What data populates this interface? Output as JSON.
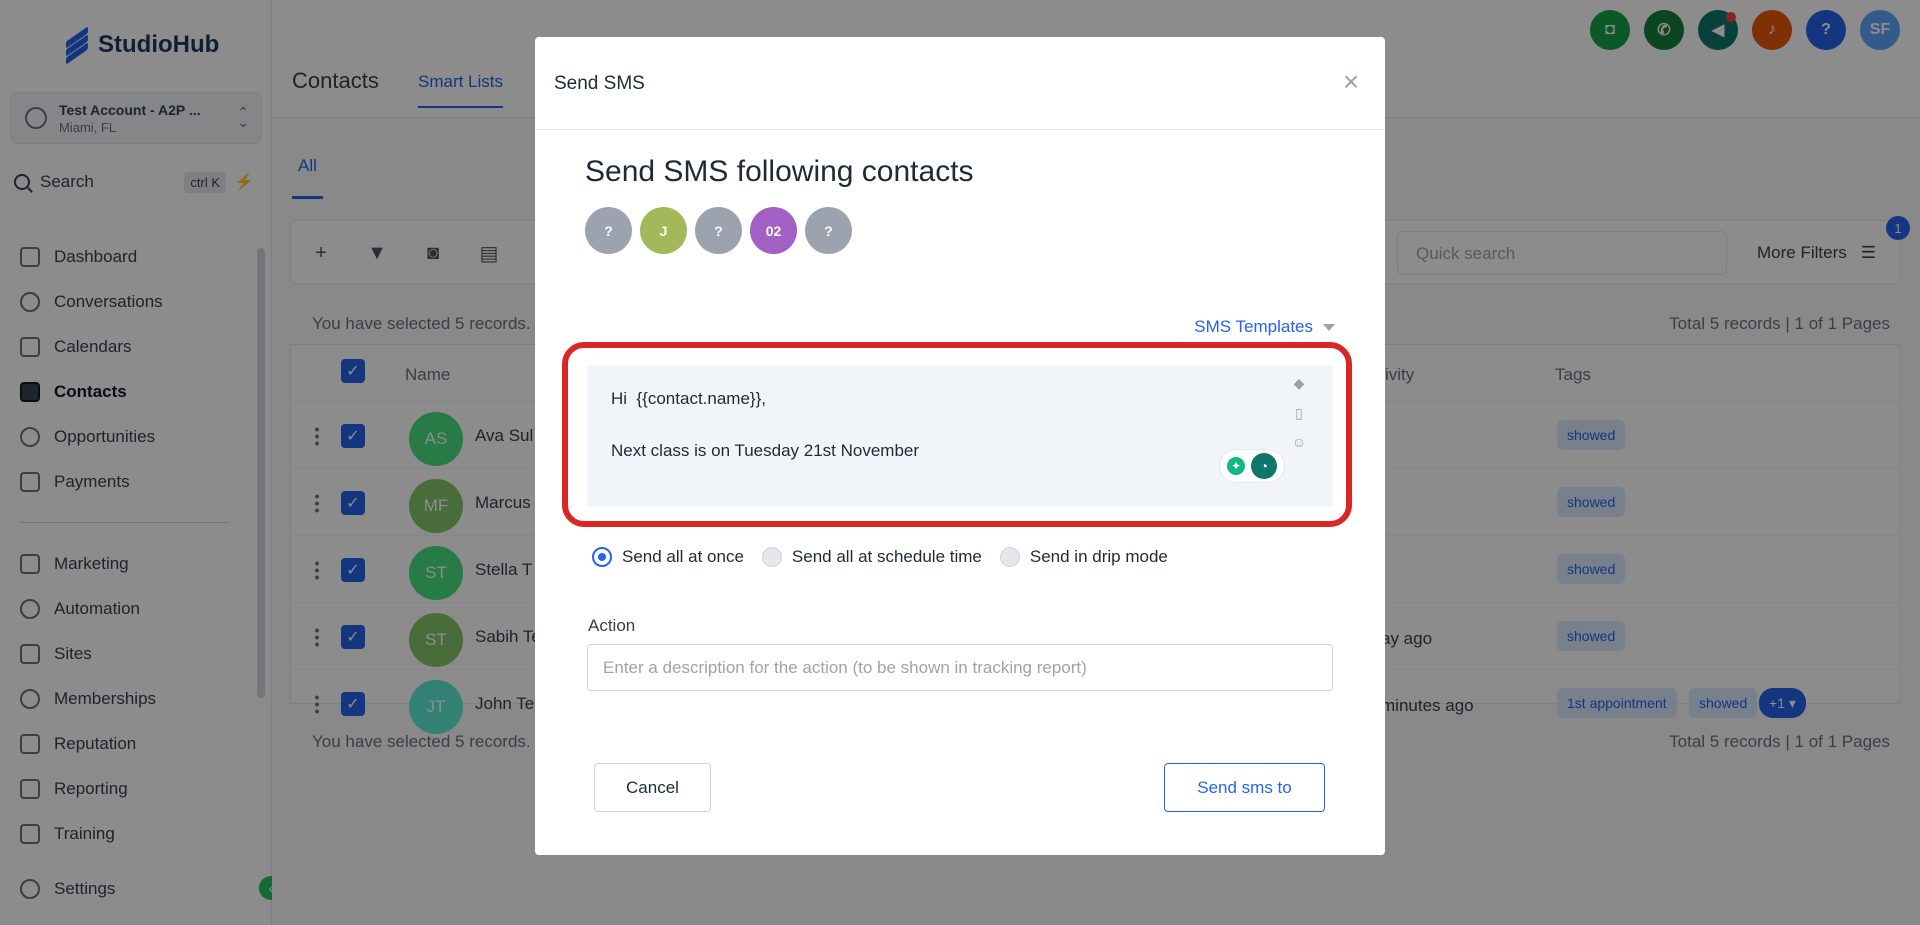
{
  "brand": {
    "name": "StudioHub"
  },
  "account": {
    "name": "Test Account - A2P ...",
    "location": "Miami, FL"
  },
  "search": {
    "label": "Search",
    "shortcut": "ctrl K"
  },
  "nav": {
    "items": [
      {
        "label": "Dashboard",
        "icon": "dashboard-icon"
      },
      {
        "label": "Conversations",
        "icon": "chat-icon"
      },
      {
        "label": "Calendars",
        "icon": "calendar-icon"
      },
      {
        "label": "Contacts",
        "icon": "contacts-icon",
        "active": true
      },
      {
        "label": "Opportunities",
        "icon": "opportunities-icon"
      },
      {
        "label": "Payments",
        "icon": "payments-icon"
      }
    ],
    "items2": [
      {
        "label": "Marketing",
        "icon": "send-icon"
      },
      {
        "label": "Automation",
        "icon": "automation-icon"
      },
      {
        "label": "Sites",
        "icon": "sites-icon"
      },
      {
        "label": "Memberships",
        "icon": "memberships-icon"
      },
      {
        "label": "Reputation",
        "icon": "star-icon"
      },
      {
        "label": "Reporting",
        "icon": "chart-icon"
      },
      {
        "label": "Training",
        "icon": "book-icon"
      }
    ],
    "settings": "Settings"
  },
  "header": {
    "title": "Contacts",
    "tab": "Smart Lists",
    "user_initials": "SF",
    "help": "?"
  },
  "content": {
    "tab_all": "All",
    "quick_search_placeholder": "Quick search",
    "more_filters": "More Filters",
    "filter_count": "1",
    "selected_text": "You have selected 5 records.",
    "total_text": "Total 5 records | 1 of 1 Pages",
    "columns": {
      "name": "Name",
      "activity": "ivity",
      "tags": "Tags"
    },
    "rows": [
      {
        "initials": "AS",
        "name": "Ava Sul",
        "activity": "",
        "tags": [
          "showed"
        ]
      },
      {
        "initials": "MF",
        "name": "Marcus",
        "activity": "",
        "tags": [
          "showed"
        ]
      },
      {
        "initials": "ST",
        "name": "Stella T",
        "activity": "",
        "tags": [
          "showed"
        ]
      },
      {
        "initials": "ST",
        "name": "Sabih Te",
        "activity": "ay ago",
        "tags": [
          "showed"
        ]
      },
      {
        "initials": "JT",
        "name": "John Te",
        "activity": "minutes ago",
        "tags": [
          "1st appointment",
          "showed"
        ],
        "more": "+1"
      }
    ]
  },
  "modal": {
    "title": "Send SMS",
    "heading": "Send SMS following contacts",
    "contacts": [
      {
        "label": "?",
        "color": "#9ca3af"
      },
      {
        "label": "J",
        "color": "#a3b85a"
      },
      {
        "label": "?",
        "color": "#9ca3af"
      },
      {
        "label": "02",
        "color": "#a25fc4"
      },
      {
        "label": "?",
        "color": "#9ca3af"
      }
    ],
    "templates_label": "SMS Templates",
    "message_line1": "Hi  {{contact.name}},",
    "message_line2": "Next class is on Tuesday 21st November",
    "radios": [
      {
        "label": "Send all at once",
        "selected": true
      },
      {
        "label": "Send all at schedule time",
        "selected": false
      },
      {
        "label": "Send in drip mode",
        "selected": false
      }
    ],
    "action_label": "Action",
    "action_placeholder": "Enter a description for the action (to be shown in tracking report)",
    "cancel": "Cancel",
    "send": "Send sms to"
  },
  "colors": {
    "accent": "#2563eb",
    "highlight": "#dc2626",
    "success": "#22c55e"
  }
}
